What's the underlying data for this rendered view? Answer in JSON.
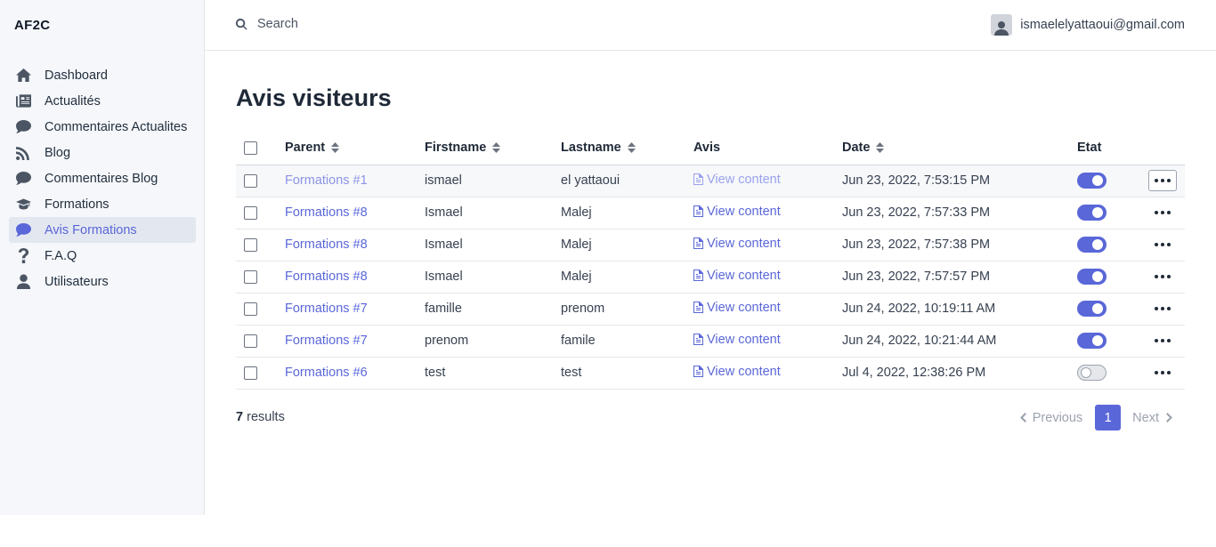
{
  "brand": "AF2C",
  "search": {
    "placeholder": "Search"
  },
  "user": {
    "email": "ismaelelyattaoui@gmail.com"
  },
  "sidebar": {
    "items": [
      {
        "label": "Dashboard",
        "icon": "home-icon"
      },
      {
        "label": "Actualités",
        "icon": "newspaper-icon"
      },
      {
        "label": "Commentaires Actualites",
        "icon": "comment-icon"
      },
      {
        "label": "Blog",
        "icon": "blog-icon"
      },
      {
        "label": "Commentaires Blog",
        "icon": "comment-icon"
      },
      {
        "label": "Formations",
        "icon": "graduation-cap-icon"
      },
      {
        "label": "Avis Formations",
        "icon": "comment-icon",
        "active": true
      },
      {
        "label": "F.A.Q",
        "icon": "question-icon"
      },
      {
        "label": "Utilisateurs",
        "icon": "user-icon"
      }
    ]
  },
  "page": {
    "title": "Avis visiteurs"
  },
  "table": {
    "columns": {
      "parent": "Parent",
      "firstname": "Firstname",
      "lastname": "Lastname",
      "avis": "Avis",
      "date": "Date",
      "etat": "Etat"
    },
    "view_label": "View content",
    "rows": [
      {
        "parent": "Formations #1",
        "firstname": "ismael",
        "lastname": "el yattaoui",
        "date": "Jun 23, 2022, 7:53:15 PM",
        "etat": true
      },
      {
        "parent": "Formations #8",
        "firstname": "Ismael",
        "lastname": "Malej",
        "date": "Jun 23, 2022, 7:57:33 PM",
        "etat": true
      },
      {
        "parent": "Formations #8",
        "firstname": "Ismael",
        "lastname": "Malej",
        "date": "Jun 23, 2022, 7:57:38 PM",
        "etat": true
      },
      {
        "parent": "Formations #8",
        "firstname": "Ismael",
        "lastname": "Malej",
        "date": "Jun 23, 2022, 7:57:57 PM",
        "etat": true
      },
      {
        "parent": "Formations #7",
        "firstname": "famille",
        "lastname": "prenom",
        "date": "Jun 24, 2022, 10:19:11 AM",
        "etat": true
      },
      {
        "parent": "Formations #7",
        "firstname": "prenom",
        "lastname": "famile",
        "date": "Jun 24, 2022, 10:21:44 AM",
        "etat": true
      },
      {
        "parent": "Formations #6",
        "firstname": "test",
        "lastname": "test",
        "date": "Jul 4, 2022, 12:38:26 PM",
        "etat": false
      }
    ]
  },
  "footer": {
    "count": "7",
    "results_label": "results"
  },
  "pagination": {
    "previous": "Previous",
    "current": "1",
    "next": "Next"
  },
  "colors": {
    "accent": "#5a67d8",
    "sidebar_bg": "#f6f7fa",
    "active_bg": "#e3e7f0"
  }
}
